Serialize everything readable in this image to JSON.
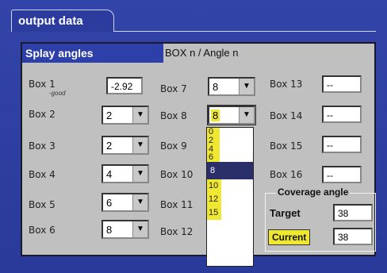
{
  "window": {
    "tab_title": "output data"
  },
  "panel": {
    "header_title": "Splay angles",
    "header_right": "BOX n / Angle n"
  },
  "boxes": [
    {
      "label": "Box 1",
      "sublabel": "-good",
      "value": "-2.92"
    },
    {
      "label": "Box 2",
      "value": "2"
    },
    {
      "label": "Box 3",
      "value": "2"
    },
    {
      "label": "Box 4",
      "value": "4"
    },
    {
      "label": "Box 5",
      "value": "6"
    },
    {
      "label": "Box 6",
      "value": "8"
    },
    {
      "label": "Box 7",
      "value": "8"
    },
    {
      "label": "Box 8",
      "value": "8"
    },
    {
      "label": "Box 9",
      "value": ""
    },
    {
      "label": "Box 10",
      "value": ""
    },
    {
      "label": "Box 11",
      "value": ""
    },
    {
      "label": "Box 12",
      "value": ""
    },
    {
      "label": "Box 13",
      "value": "--"
    },
    {
      "label": "Box 14",
      "value": "--"
    },
    {
      "label": "Box 15",
      "value": "--"
    },
    {
      "label": "Box 16",
      "value": "--"
    }
  ],
  "dropdown": {
    "options": [
      "0",
      "2",
      "4",
      "6",
      "8",
      "10",
      "12",
      "15"
    ],
    "selected": "8"
  },
  "coverage": {
    "title": "Coverage angle",
    "target_label": "Target",
    "target_value": "38",
    "current_label": "Current",
    "current_value": "38"
  },
  "colors": {
    "frame": "#3344a8",
    "panel": "#c0c0c0",
    "highlight": "#f0e830",
    "selected": "#2a2f6a"
  },
  "icons": {
    "combo_arrow": "dropdown-arrow-icon"
  }
}
